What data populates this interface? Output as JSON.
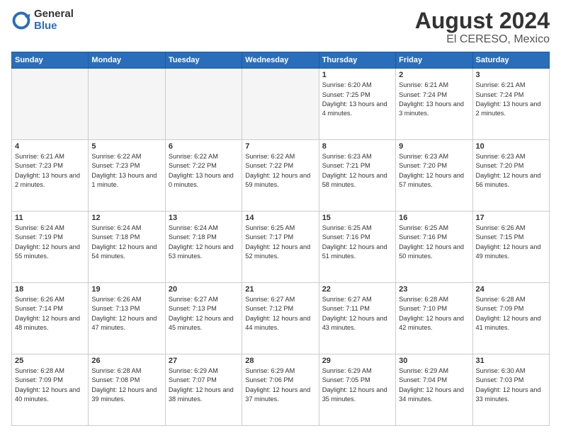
{
  "header": {
    "logo_general": "General",
    "logo_blue": "Blue",
    "title": "August 2024",
    "location": "El CERESO, Mexico"
  },
  "days_of_week": [
    "Sunday",
    "Monday",
    "Tuesday",
    "Wednesday",
    "Thursday",
    "Friday",
    "Saturday"
  ],
  "weeks": [
    [
      {
        "day": "",
        "empty": true
      },
      {
        "day": "",
        "empty": true
      },
      {
        "day": "",
        "empty": true
      },
      {
        "day": "",
        "empty": true
      },
      {
        "day": "1",
        "sunrise": "6:20 AM",
        "sunset": "7:25 PM",
        "daylight": "13 hours and 4 minutes."
      },
      {
        "day": "2",
        "sunrise": "6:21 AM",
        "sunset": "7:24 PM",
        "daylight": "13 hours and 3 minutes."
      },
      {
        "day": "3",
        "sunrise": "6:21 AM",
        "sunset": "7:24 PM",
        "daylight": "13 hours and 2 minutes."
      }
    ],
    [
      {
        "day": "4",
        "sunrise": "6:21 AM",
        "sunset": "7:23 PM",
        "daylight": "13 hours and 2 minutes."
      },
      {
        "day": "5",
        "sunrise": "6:22 AM",
        "sunset": "7:23 PM",
        "daylight": "13 hours and 1 minute."
      },
      {
        "day": "6",
        "sunrise": "6:22 AM",
        "sunset": "7:22 PM",
        "daylight": "13 hours and 0 minutes."
      },
      {
        "day": "7",
        "sunrise": "6:22 AM",
        "sunset": "7:22 PM",
        "daylight": "12 hours and 59 minutes."
      },
      {
        "day": "8",
        "sunrise": "6:23 AM",
        "sunset": "7:21 PM",
        "daylight": "12 hours and 58 minutes."
      },
      {
        "day": "9",
        "sunrise": "6:23 AM",
        "sunset": "7:20 PM",
        "daylight": "12 hours and 57 minutes."
      },
      {
        "day": "10",
        "sunrise": "6:23 AM",
        "sunset": "7:20 PM",
        "daylight": "12 hours and 56 minutes."
      }
    ],
    [
      {
        "day": "11",
        "sunrise": "6:24 AM",
        "sunset": "7:19 PM",
        "daylight": "12 hours and 55 minutes."
      },
      {
        "day": "12",
        "sunrise": "6:24 AM",
        "sunset": "7:18 PM",
        "daylight": "12 hours and 54 minutes."
      },
      {
        "day": "13",
        "sunrise": "6:24 AM",
        "sunset": "7:18 PM",
        "daylight": "12 hours and 53 minutes."
      },
      {
        "day": "14",
        "sunrise": "6:25 AM",
        "sunset": "7:17 PM",
        "daylight": "12 hours and 52 minutes."
      },
      {
        "day": "15",
        "sunrise": "6:25 AM",
        "sunset": "7:16 PM",
        "daylight": "12 hours and 51 minutes."
      },
      {
        "day": "16",
        "sunrise": "6:25 AM",
        "sunset": "7:16 PM",
        "daylight": "12 hours and 50 minutes."
      },
      {
        "day": "17",
        "sunrise": "6:26 AM",
        "sunset": "7:15 PM",
        "daylight": "12 hours and 49 minutes."
      }
    ],
    [
      {
        "day": "18",
        "sunrise": "6:26 AM",
        "sunset": "7:14 PM",
        "daylight": "12 hours and 48 minutes."
      },
      {
        "day": "19",
        "sunrise": "6:26 AM",
        "sunset": "7:13 PM",
        "daylight": "12 hours and 47 minutes."
      },
      {
        "day": "20",
        "sunrise": "6:27 AM",
        "sunset": "7:13 PM",
        "daylight": "12 hours and 45 minutes."
      },
      {
        "day": "21",
        "sunrise": "6:27 AM",
        "sunset": "7:12 PM",
        "daylight": "12 hours and 44 minutes."
      },
      {
        "day": "22",
        "sunrise": "6:27 AM",
        "sunset": "7:11 PM",
        "daylight": "12 hours and 43 minutes."
      },
      {
        "day": "23",
        "sunrise": "6:28 AM",
        "sunset": "7:10 PM",
        "daylight": "12 hours and 42 minutes."
      },
      {
        "day": "24",
        "sunrise": "6:28 AM",
        "sunset": "7:09 PM",
        "daylight": "12 hours and 41 minutes."
      }
    ],
    [
      {
        "day": "25",
        "sunrise": "6:28 AM",
        "sunset": "7:09 PM",
        "daylight": "12 hours and 40 minutes."
      },
      {
        "day": "26",
        "sunrise": "6:28 AM",
        "sunset": "7:08 PM",
        "daylight": "12 hours and 39 minutes."
      },
      {
        "day": "27",
        "sunrise": "6:29 AM",
        "sunset": "7:07 PM",
        "daylight": "12 hours and 38 minutes."
      },
      {
        "day": "28",
        "sunrise": "6:29 AM",
        "sunset": "7:06 PM",
        "daylight": "12 hours and 37 minutes."
      },
      {
        "day": "29",
        "sunrise": "6:29 AM",
        "sunset": "7:05 PM",
        "daylight": "12 hours and 35 minutes."
      },
      {
        "day": "30",
        "sunrise": "6:29 AM",
        "sunset": "7:04 PM",
        "daylight": "12 hours and 34 minutes."
      },
      {
        "day": "31",
        "sunrise": "6:30 AM",
        "sunset": "7:03 PM",
        "daylight": "12 hours and 33 minutes."
      }
    ]
  ]
}
